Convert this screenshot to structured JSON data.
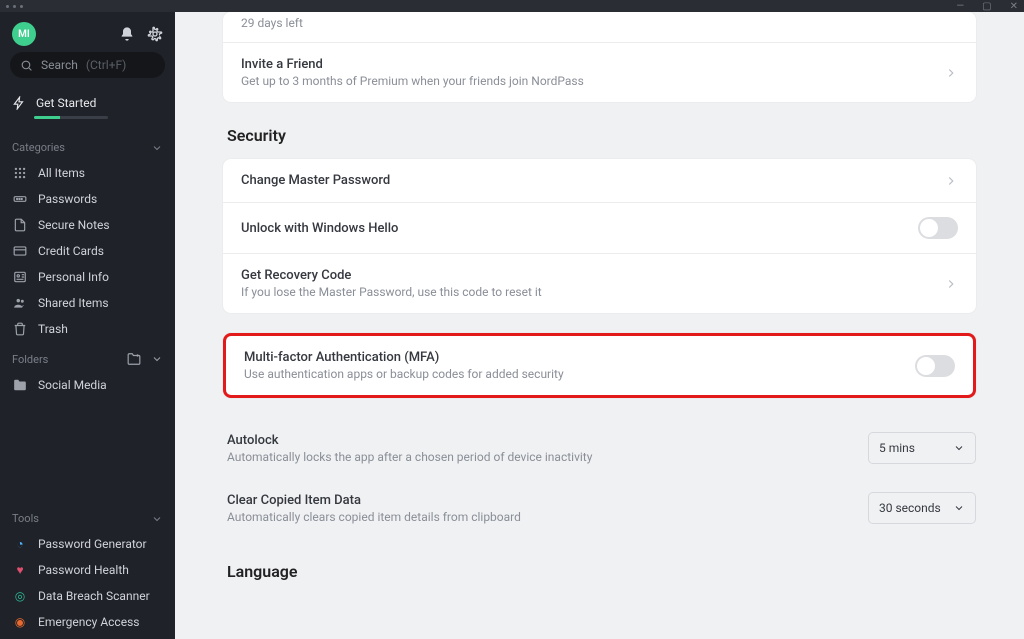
{
  "titlebar": {
    "avatar_initials": "MI"
  },
  "search": {
    "label": "Search",
    "hint": "(Ctrl+F)"
  },
  "get_started": {
    "label": "Get Started"
  },
  "categories": {
    "header": "Categories",
    "items": [
      {
        "label": "All Items"
      },
      {
        "label": "Passwords"
      },
      {
        "label": "Secure Notes"
      },
      {
        "label": "Credit Cards"
      },
      {
        "label": "Personal Info"
      },
      {
        "label": "Shared Items"
      },
      {
        "label": "Trash"
      }
    ]
  },
  "folders": {
    "header": "Folders",
    "items": [
      {
        "label": "Social Media"
      }
    ]
  },
  "tools": {
    "header": "Tools",
    "items": [
      {
        "label": "Password Generator"
      },
      {
        "label": "Password Health"
      },
      {
        "label": "Data Breach Scanner"
      },
      {
        "label": "Emergency Access"
      }
    ]
  },
  "trial": {
    "days_left": "29 days left"
  },
  "invite": {
    "title": "Invite a Friend",
    "sub": "Get up to 3 months of Premium when your friends join NordPass"
  },
  "security": {
    "header": "Security",
    "change_pw": {
      "title": "Change Master Password"
    },
    "winhello": {
      "title": "Unlock with Windows Hello"
    },
    "recovery": {
      "title": "Get Recovery Code",
      "sub": "If you lose the Master Password, use this code to reset it"
    },
    "mfa": {
      "title": "Multi-factor Authentication (MFA)",
      "sub": "Use authentication apps or backup codes for added security"
    },
    "autolock": {
      "title": "Autolock",
      "sub": "Automatically locks the app after a chosen period of device inactivity",
      "value": "5 mins"
    },
    "clear": {
      "title": "Clear Copied Item Data",
      "sub": "Automatically clears copied item details from clipboard",
      "value": "30 seconds"
    }
  },
  "language": {
    "header": "Language"
  }
}
